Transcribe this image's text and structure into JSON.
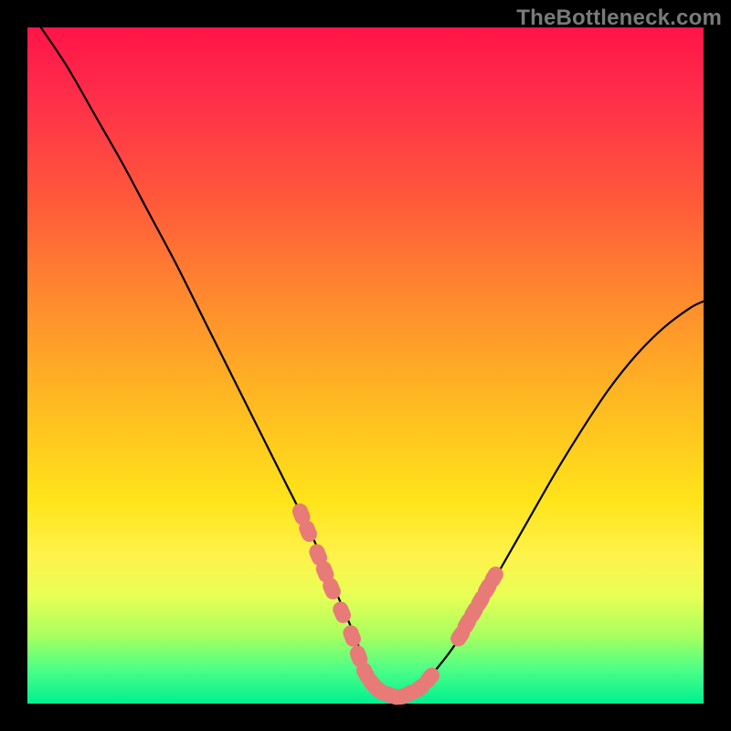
{
  "watermark": "TheBottleneck.com",
  "colors": {
    "frame": "#000000",
    "curve": "#000000",
    "marker": "#e87a78",
    "gradient_top": "#ff1448",
    "gradient_bottom": "#00f08f"
  },
  "chart_data": {
    "type": "line",
    "title": "",
    "xlabel": "",
    "ylabel": "",
    "xlim": [
      0,
      100
    ],
    "ylim": [
      0,
      100
    ],
    "note": "V-shaped bottleneck curve; y approximates bottleneck % vs. a component-ratio x-axis. No axis tick labels are shown; values are read by vertical position within the plot area.",
    "series": [
      {
        "name": "curve",
        "x": [
          2,
          6,
          10,
          14,
          18,
          22,
          26,
          30,
          34,
          38,
          42,
          45,
          48,
          50,
          52,
          55,
          58,
          62,
          66,
          70,
          74,
          78,
          82,
          86,
          90,
          94,
          98,
          100
        ],
        "y": [
          100,
          94,
          87,
          80,
          72.5,
          65,
          57,
          49,
          41,
          33,
          25,
          18,
          11,
          6,
          2.5,
          1,
          2.5,
          7,
          13,
          20,
          27,
          34,
          40.5,
          46.5,
          51.5,
          55.5,
          58.5,
          59.5
        ]
      }
    ],
    "markers": [
      {
        "x": 40.5,
        "y": 28.0
      },
      {
        "x": 41.5,
        "y": 25.5
      },
      {
        "x": 43.0,
        "y": 22.0
      },
      {
        "x": 44.0,
        "y": 19.5
      },
      {
        "x": 45.0,
        "y": 17.0
      },
      {
        "x": 46.5,
        "y": 13.5
      },
      {
        "x": 48.0,
        "y": 10.0
      },
      {
        "x": 49.0,
        "y": 7.0
      },
      {
        "x": 50.0,
        "y": 4.5
      },
      {
        "x": 51.0,
        "y": 3.0
      },
      {
        "x": 52.0,
        "y": 2.0
      },
      {
        "x": 53.5,
        "y": 1.3
      },
      {
        "x": 55.0,
        "y": 1.0
      },
      {
        "x": 56.5,
        "y": 1.5
      },
      {
        "x": 58.0,
        "y": 2.3
      },
      {
        "x": 59.5,
        "y": 3.8
      },
      {
        "x": 64.0,
        "y": 10.0
      },
      {
        "x": 65.0,
        "y": 11.8
      },
      {
        "x": 66.0,
        "y": 13.5
      },
      {
        "x": 67.0,
        "y": 15.2
      },
      {
        "x": 68.0,
        "y": 17.0
      },
      {
        "x": 69.0,
        "y": 18.7
      }
    ]
  }
}
